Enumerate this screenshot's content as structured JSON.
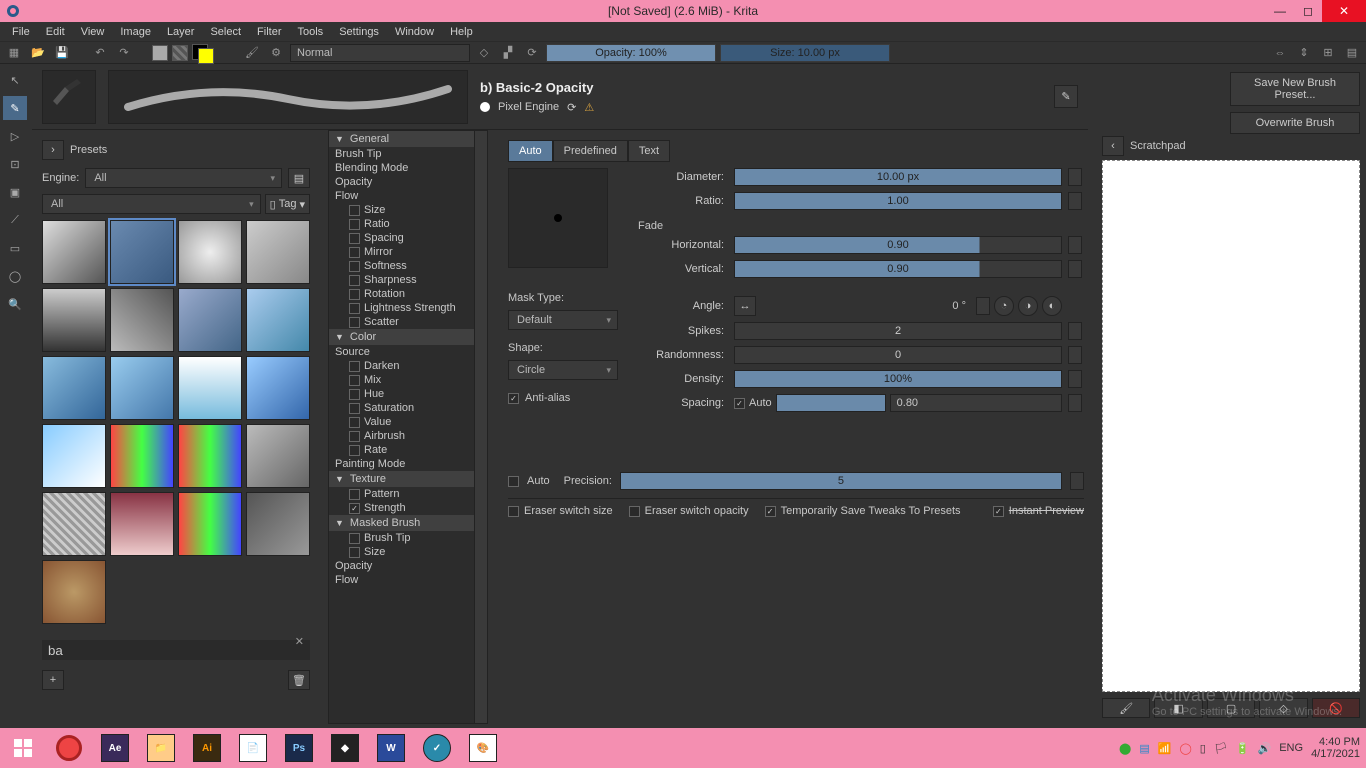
{
  "titlebar": {
    "title": "[Not Saved]  (2.6 MiB)  -  Krita"
  },
  "menu": [
    "File",
    "Edit",
    "View",
    "Image",
    "Layer",
    "Select",
    "Filter",
    "Tools",
    "Settings",
    "Window",
    "Help"
  ],
  "toolbar": {
    "blendMode": "Normal",
    "opacity": "Opacity: 100%",
    "size": "Size: 10.00 px"
  },
  "brushHeader": {
    "name": "b) Basic-2 Opacity",
    "engine": "Pixel Engine"
  },
  "rightButtons": {
    "saveNew": "Save New Brush Preset...",
    "overwrite": "Overwrite Brush"
  },
  "presets": {
    "heading": "Presets",
    "engineLabel": "Engine:",
    "engineValue": "All",
    "tagValue": "All",
    "tagLabel": "Tag",
    "search": "ba"
  },
  "settingsList": {
    "general": "General",
    "items": [
      "Brush Tip",
      "Blending Mode",
      "Opacity",
      "Flow"
    ],
    "checks": [
      "Size",
      "Ratio",
      "Spacing",
      "Mirror",
      "Softness",
      "Sharpness",
      "Rotation",
      "Lightness Strength",
      "Scatter"
    ],
    "color": "Color",
    "source": "Source",
    "colItems": [
      "Darken",
      "Mix",
      "Hue",
      "Saturation",
      "Value",
      "Airbrush",
      "Rate"
    ],
    "paintingMode": "Painting Mode",
    "texture": "Texture",
    "texItems": [
      "Pattern",
      "Strength"
    ],
    "masked": "Masked Brush",
    "maskedItems": [
      "Brush Tip",
      "Size"
    ],
    "opacity": "Opacity",
    "flow": "Flow"
  },
  "mainPanel": {
    "tabs": [
      "Auto",
      "Predefined",
      "Text"
    ],
    "diameter": {
      "label": "Diameter:",
      "value": "10.00 px"
    },
    "ratio": {
      "label": "Ratio:",
      "value": "1.00"
    },
    "fade": "Fade",
    "horizontal": {
      "label": "Horizontal:",
      "value": "0.90"
    },
    "vertical": {
      "label": "Vertical:",
      "value": "0.90"
    },
    "maskType": {
      "label": "Mask Type:",
      "value": "Default"
    },
    "shape": {
      "label": "Shape:",
      "value": "Circle"
    },
    "antialias": "Anti-alias",
    "angle": {
      "label": "Angle:",
      "value": "0 °"
    },
    "spikes": {
      "label": "Spikes:",
      "value": "2"
    },
    "randomness": {
      "label": "Randomness:",
      "value": "0"
    },
    "density": {
      "label": "Density:",
      "value": "100%"
    },
    "spacing": {
      "label": "Spacing:",
      "auto": "Auto",
      "value": "0.80"
    },
    "precisionAuto": "Auto",
    "precision": {
      "label": "Precision:",
      "value": "5"
    },
    "eraser1": "Eraser switch size",
    "eraser2": "Eraser switch opacity",
    "tempSave": "Temporarily Save Tweaks To Presets",
    "instant": "Instant Preview"
  },
  "scratch": {
    "label": "Scratchpad"
  },
  "watermark": {
    "title": "Activate Windows",
    "sub": "Go to PC settings to activate Windows."
  },
  "taskbar": {
    "lang": "ENG",
    "time": "4:40 PM",
    "date": "4/17/2021"
  }
}
